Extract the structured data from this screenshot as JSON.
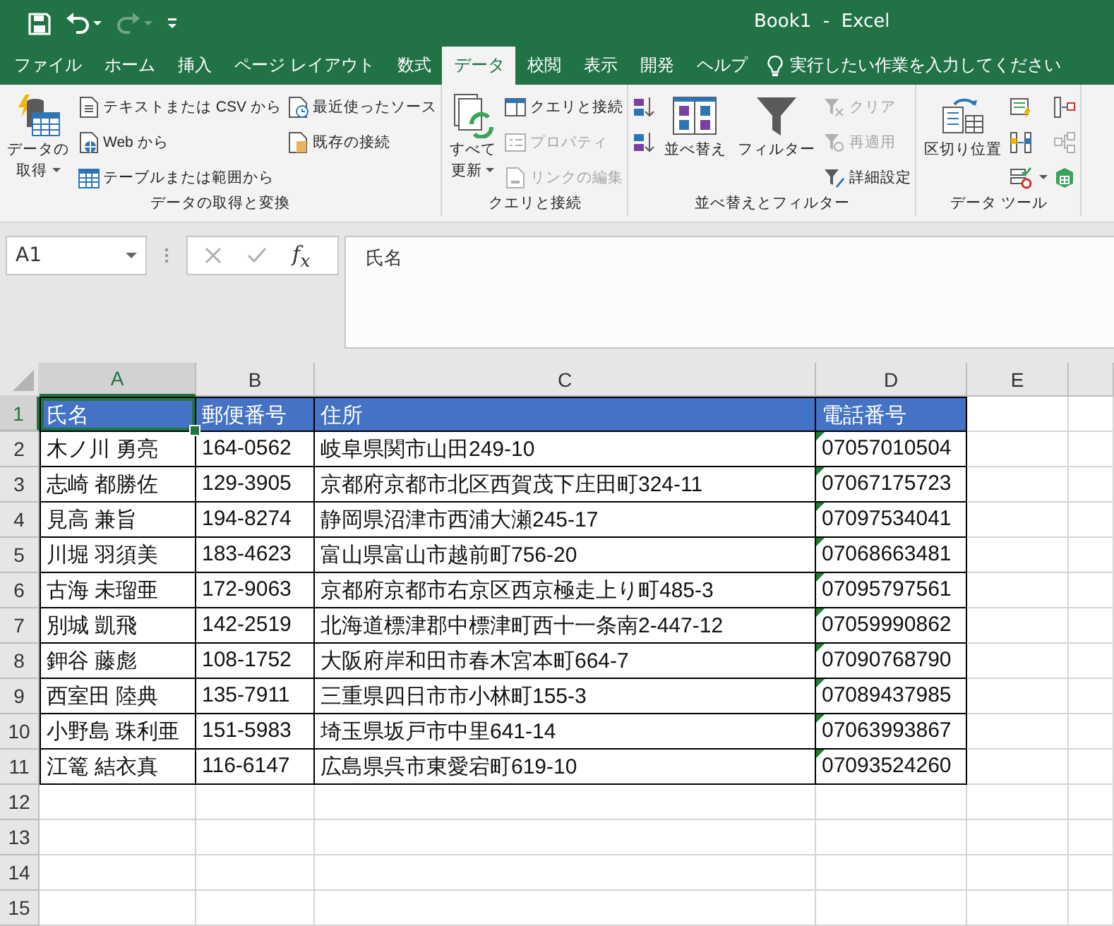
{
  "title_bar": {
    "title": "Book1  -  Excel",
    "quick_access": [
      {
        "kind": "save",
        "disabled": false
      },
      {
        "kind": "undo",
        "disabled": false
      },
      {
        "kind": "redo",
        "disabled": true
      },
      {
        "kind": "customize",
        "disabled": false
      }
    ]
  },
  "tabs": [
    {
      "label": "ファイル",
      "selected": false
    },
    {
      "label": "ホーム",
      "selected": false
    },
    {
      "label": "挿入",
      "selected": false
    },
    {
      "label": "ページ レイアウト",
      "selected": false
    },
    {
      "label": "数式",
      "selected": false
    },
    {
      "label": "データ",
      "selected": true
    },
    {
      "label": "校閲",
      "selected": false
    },
    {
      "label": "表示",
      "selected": false
    },
    {
      "label": "開発",
      "selected": false
    },
    {
      "label": "ヘルプ",
      "selected": false
    }
  ],
  "tell_me": {
    "placeholder": "実行したい作業を入力してください"
  },
  "ribbon": [
    {
      "name": "データの取得と変換",
      "items": [
        {
          "kind": "large",
          "lines": [
            "データの",
            "取得"
          ],
          "dropdown": true,
          "disabled": false
        },
        {
          "kind": "small",
          "label": "テキストまたは CSV から",
          "dropdown": false,
          "disabled": false
        },
        {
          "kind": "small",
          "label": "Web から",
          "dropdown": false,
          "disabled": false
        },
        {
          "kind": "small",
          "label": "テーブルまたは範囲から",
          "dropdown": false,
          "disabled": false
        },
        {
          "kind": "small",
          "label": "最近使ったソース",
          "dropdown": false,
          "disabled": false
        },
        {
          "kind": "small",
          "label": "既存の接続",
          "dropdown": false,
          "disabled": false
        }
      ]
    },
    {
      "name": "クエリと接続",
      "items": [
        {
          "kind": "large",
          "lines": [
            "すべて",
            "更新"
          ],
          "dropdown": true,
          "disabled": false
        },
        {
          "kind": "small",
          "label": "クエリと接続",
          "dropdown": false,
          "disabled": false
        },
        {
          "kind": "small",
          "label": "プロパティ",
          "dropdown": false,
          "disabled": true
        },
        {
          "kind": "small",
          "label": "リンクの編集",
          "dropdown": false,
          "disabled": true
        }
      ]
    },
    {
      "name": "並べ替えとフィルター",
      "items": [
        {
          "kind": "icon",
          "dropdown": false,
          "disabled": false
        },
        {
          "kind": "icon",
          "dropdown": false,
          "disabled": false
        },
        {
          "kind": "large",
          "lines": [
            "並べ替え"
          ],
          "dropdown": false,
          "disabled": false
        },
        {
          "kind": "large",
          "lines": [
            "フィルター"
          ],
          "dropdown": false,
          "disabled": false
        },
        {
          "kind": "small",
          "label": "クリア",
          "dropdown": false,
          "disabled": true
        },
        {
          "kind": "small",
          "label": "再適用",
          "dropdown": false,
          "disabled": true
        },
        {
          "kind": "small",
          "label": "詳細設定",
          "dropdown": false,
          "disabled": false
        }
      ]
    },
    {
      "name": "データ ツール",
      "items": [
        {
          "kind": "large",
          "lines": [
            "区切り位置"
          ],
          "dropdown": false,
          "disabled": false
        },
        {
          "kind": "icon",
          "dropdown": false,
          "disabled": false
        },
        {
          "kind": "icon",
          "dropdown": false,
          "disabled": false
        },
        {
          "kind": "icon",
          "dropdown": true,
          "disabled": false
        },
        {
          "kind": "icon",
          "dropdown": false,
          "disabled": false
        },
        {
          "kind": "icon",
          "dropdown": false,
          "disabled": true
        },
        {
          "kind": "icon",
          "dropdown": false,
          "disabled": false
        }
      ]
    }
  ],
  "formula_bar": {
    "name_box": "A1",
    "insert_function": "f$_{x}$",
    "formula": "氏名"
  },
  "sheet": {
    "columns": [
      {
        "label": "A",
        "selected": true
      },
      {
        "label": "B",
        "selected": false
      },
      {
        "label": "C",
        "selected": false
      },
      {
        "label": "D",
        "selected": false
      },
      {
        "label": "E",
        "selected": false
      }
    ],
    "rows": [
      {
        "number": "1",
        "selected": true,
        "kind": "header",
        "cells": [
          {
            "text": "氏名",
            "selected": true,
            "flagged": false
          },
          {
            "text": "郵便番号",
            "selected": false,
            "flagged": false
          },
          {
            "text": "住所",
            "selected": false,
            "flagged": false
          },
          {
            "text": "電話番号",
            "selected": false,
            "flagged": false
          }
        ]
      },
      {
        "number": "2",
        "selected": false,
        "kind": "data",
        "cells": [
          {
            "text": "木ノ川 勇亮",
            "selected": false,
            "flagged": false
          },
          {
            "text": "164-0562",
            "selected": false,
            "flagged": false
          },
          {
            "text": "岐阜県関市山田249-10",
            "selected": false,
            "flagged": false
          },
          {
            "text": "07057010504",
            "selected": false,
            "flagged": true
          }
        ]
      },
      {
        "number": "3",
        "selected": false,
        "kind": "data",
        "cells": [
          {
            "text": "志崎 都勝佐",
            "selected": false,
            "flagged": false
          },
          {
            "text": "129-3905",
            "selected": false,
            "flagged": false
          },
          {
            "text": "京都府京都市北区西賀茂下庄田町324-11",
            "selected": false,
            "flagged": false
          },
          {
            "text": "07067175723",
            "selected": false,
            "flagged": true
          }
        ]
      },
      {
        "number": "4",
        "selected": false,
        "kind": "data",
        "cells": [
          {
            "text": "見高 兼旨",
            "selected": false,
            "flagged": false
          },
          {
            "text": "194-8274",
            "selected": false,
            "flagged": false
          },
          {
            "text": "静岡県沼津市西浦大瀬245-17",
            "selected": false,
            "flagged": false
          },
          {
            "text": "07097534041",
            "selected": false,
            "flagged": true
          }
        ]
      },
      {
        "number": "5",
        "selected": false,
        "kind": "data",
        "cells": [
          {
            "text": "川堀 羽須美",
            "selected": false,
            "flagged": false
          },
          {
            "text": "183-4623",
            "selected": false,
            "flagged": false
          },
          {
            "text": "富山県富山市越前町756-20",
            "selected": false,
            "flagged": false
          },
          {
            "text": "07068663481",
            "selected": false,
            "flagged": true
          }
        ]
      },
      {
        "number": "6",
        "selected": false,
        "kind": "data",
        "cells": [
          {
            "text": "古海 未瑠亜",
            "selected": false,
            "flagged": false
          },
          {
            "text": "172-9063",
            "selected": false,
            "flagged": false
          },
          {
            "text": "京都府京都市右京区西京極走上り町485-3",
            "selected": false,
            "flagged": false
          },
          {
            "text": "07095797561",
            "selected": false,
            "flagged": true
          }
        ]
      },
      {
        "number": "7",
        "selected": false,
        "kind": "data",
        "cells": [
          {
            "text": "別城 凱飛",
            "selected": false,
            "flagged": false
          },
          {
            "text": "142-2519",
            "selected": false,
            "flagged": false
          },
          {
            "text": "北海道標津郡中標津町西十一条南2-447-12",
            "selected": false,
            "flagged": false
          },
          {
            "text": "07059990862",
            "selected": false,
            "flagged": true
          }
        ]
      },
      {
        "number": "8",
        "selected": false,
        "kind": "data",
        "cells": [
          {
            "text": "鉀谷 藤彪",
            "selected": false,
            "flagged": false
          },
          {
            "text": "108-1752",
            "selected": false,
            "flagged": false
          },
          {
            "text": "大阪府岸和田市春木宮本町664-7",
            "selected": false,
            "flagged": false
          },
          {
            "text": "07090768790",
            "selected": false,
            "flagged": true
          }
        ]
      },
      {
        "number": "9",
        "selected": false,
        "kind": "data",
        "cells": [
          {
            "text": "西室田 陸典",
            "selected": false,
            "flagged": false
          },
          {
            "text": "135-7911",
            "selected": false,
            "flagged": false
          },
          {
            "text": "三重県四日市市小林町155-3",
            "selected": false,
            "flagged": false
          },
          {
            "text": "07089437985",
            "selected": false,
            "flagged": true
          }
        ]
      },
      {
        "number": "10",
        "selected": false,
        "kind": "data",
        "cells": [
          {
            "text": "小野島 珠利亜",
            "selected": false,
            "flagged": false
          },
          {
            "text": "151-5983",
            "selected": false,
            "flagged": false
          },
          {
            "text": "埼玉県坂戸市中里641-14",
            "selected": false,
            "flagged": false
          },
          {
            "text": "07063993867",
            "selected": false,
            "flagged": true
          }
        ]
      },
      {
        "number": "11",
        "selected": false,
        "kind": "data",
        "cells": [
          {
            "text": "江篭 結衣真",
            "selected": false,
            "flagged": false
          },
          {
            "text": "116-6147",
            "selected": false,
            "flagged": false
          },
          {
            "text": "広島県呉市東愛宕町619-10",
            "selected": false,
            "flagged": false
          },
          {
            "text": "07093524260",
            "selected": false,
            "flagged": true
          }
        ]
      },
      {
        "number": "12",
        "selected": false,
        "kind": "empty"
      },
      {
        "number": "13",
        "selected": false,
        "kind": "empty"
      },
      {
        "number": "14",
        "selected": false,
        "kind": "empty"
      },
      {
        "number": "15",
        "selected": false,
        "kind": "empty"
      }
    ]
  }
}
